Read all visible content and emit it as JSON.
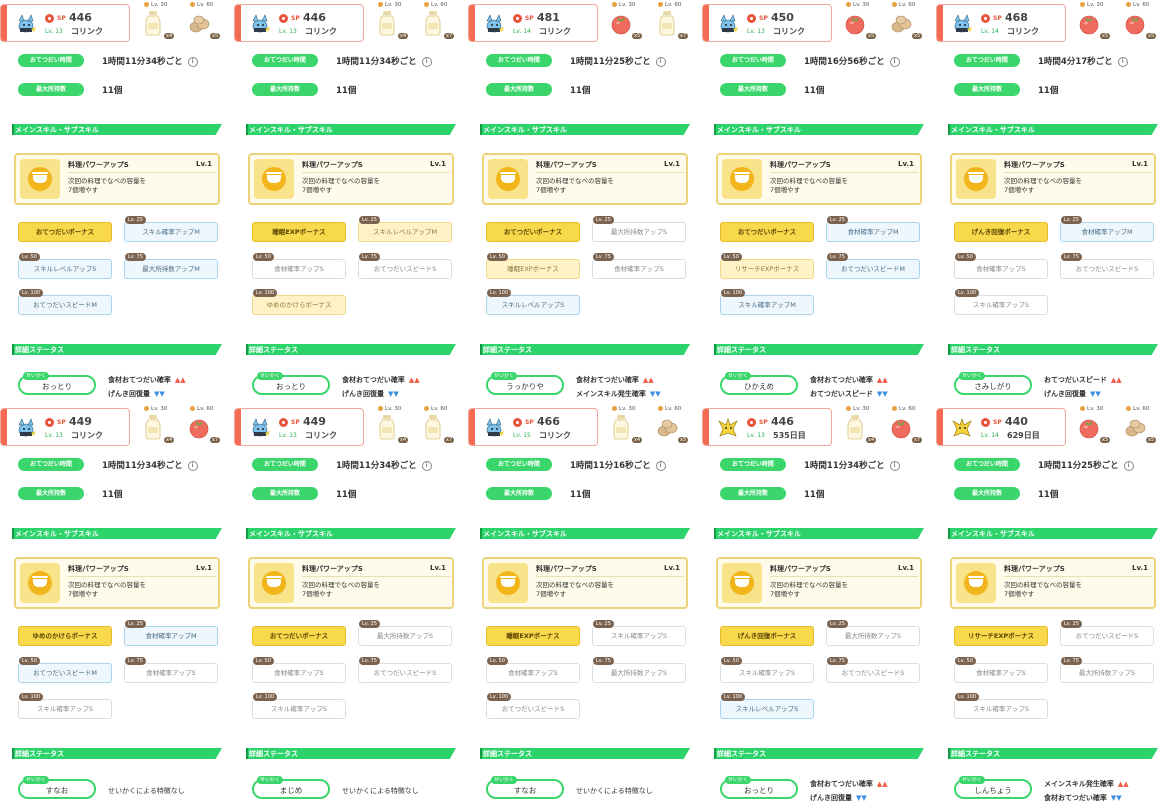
{
  "labels": {
    "help_interval": "おてつだい時間",
    "max_carry": "最大所持数",
    "skills_section": "メインスキル・サブスキル",
    "status_section": "詳細ステータス",
    "nature_tag": "せいかく",
    "sp_label": "SP",
    "up_arrows": "▲▲",
    "down_arrows": "▼▼"
  },
  "colors": {
    "accent_green": "#3bd66b",
    "header_red": "#f26b52",
    "skill_gold": "#f2b51a"
  },
  "panels": [
    {
      "sp": "446",
      "level": "Lv. 13",
      "name": "コリンク",
      "mon": "blue",
      "ing1": {
        "lv": "Lv. 30",
        "type": "milk",
        "count": "x4"
      },
      "ing2": {
        "lv": "Lv. 60",
        "type": "potato",
        "count": "x5"
      },
      "interval": "1時間11分34秒ごと",
      "capacity": "11個",
      "skill": {
        "name": "料理パワーアップS",
        "level": "Lv.1",
        "desc1": "次回の料理でなべの容量を",
        "desc2": "7個増やす"
      },
      "subs": [
        {
          "lv": "",
          "label": "おてつだいボーナス",
          "style": "gold"
        },
        {
          "lv": "Lv. 25",
          "label": "スキル確率アップM",
          "style": "blue"
        },
        {
          "lv": "Lv. 50",
          "label": "スキルレベルアップS",
          "style": "blue"
        },
        {
          "lv": "Lv. 75",
          "label": "最大所持数アップM",
          "style": "blue"
        },
        {
          "lv": "Lv. 100",
          "label": "おてつだいスピードM",
          "style": "blue"
        }
      ],
      "nature": "おっとり",
      "eff1": "食材おてつだい確率",
      "eff1dir": "up",
      "eff2": "げんき回復量",
      "eff2dir": "down"
    },
    {
      "sp": "446",
      "level": "Lv. 13",
      "name": "コリンク",
      "mon": "blue",
      "ing1": {
        "lv": "Lv. 30",
        "type": "milk",
        "count": "x4"
      },
      "ing2": {
        "lv": "Lv. 60",
        "type": "milk",
        "count": "x7"
      },
      "interval": "1時間11分34秒ごと",
      "capacity": "11個",
      "skill": {
        "name": "料理パワーアップS",
        "level": "Lv.1",
        "desc1": "次回の料理でなべの容量を",
        "desc2": "7個増やす"
      },
      "subs": [
        {
          "lv": "",
          "label": "睡眠EXPボーナス",
          "style": "gold"
        },
        {
          "lv": "Lv. 25",
          "label": "スキルレベルアップM",
          "style": "cream"
        },
        {
          "lv": "Lv. 50",
          "label": "食材確率アップS",
          "style": "white"
        },
        {
          "lv": "Lv. 75",
          "label": "おてつだいスピードS",
          "style": "white"
        },
        {
          "lv": "Lv. 100",
          "label": "ゆめのかけらボーナス",
          "style": "cream"
        }
      ],
      "nature": "おっとり",
      "eff1": "食材おてつだい確率",
      "eff1dir": "up",
      "eff2": "げんき回復量",
      "eff2dir": "down"
    },
    {
      "sp": "481",
      "level": "Lv. 14",
      "name": "コリンク",
      "mon": "blue",
      "ing1": {
        "lv": "Lv. 30",
        "type": "tomato",
        "count": "x5"
      },
      "ing2": {
        "lv": "Lv. 60",
        "type": "milk",
        "count": "x7"
      },
      "interval": "1時間11分25秒ごと",
      "capacity": "11個",
      "skill": {
        "name": "料理パワーアップS",
        "level": "Lv.1",
        "desc1": "次回の料理でなべの容量を",
        "desc2": "7個増やす"
      },
      "subs": [
        {
          "lv": "",
          "label": "おてつだいボーナス",
          "style": "gold"
        },
        {
          "lv": "Lv. 25",
          "label": "最大所持数アップS",
          "style": "white"
        },
        {
          "lv": "Lv. 50",
          "label": "睡眠EXPボーナス",
          "style": "cream"
        },
        {
          "lv": "Lv. 75",
          "label": "食材確率アップS",
          "style": "white"
        },
        {
          "lv": "Lv. 100",
          "label": "スキルレベルアップS",
          "style": "blue"
        }
      ],
      "nature": "うっかりや",
      "eff1": "食材おてつだい確率",
      "eff1dir": "up",
      "eff2": "メインスキル発生確率",
      "eff2dir": "down"
    },
    {
      "sp": "450",
      "level": "Lv. 13",
      "name": "コリンク",
      "mon": "blue",
      "ing1": {
        "lv": "Lv. 30",
        "type": "tomato",
        "count": "x5"
      },
      "ing2": {
        "lv": "Lv. 60",
        "type": "potato",
        "count": "x5"
      },
      "interval": "1時間16分56秒ごと",
      "capacity": "11個",
      "skill": {
        "name": "料理パワーアップS",
        "level": "Lv.1",
        "desc1": "次回の料理でなべの容量を",
        "desc2": "7個増やす"
      },
      "subs": [
        {
          "lv": "",
          "label": "おてつだいボーナス",
          "style": "gold"
        },
        {
          "lv": "Lv. 25",
          "label": "食材確率アップM",
          "style": "blue"
        },
        {
          "lv": "Lv. 50",
          "label": "リサーチEXPボーナス",
          "style": "cream"
        },
        {
          "lv": "Lv. 75",
          "label": "おてつだいスピードM",
          "style": "blue"
        },
        {
          "lv": "Lv. 100",
          "label": "スキル確率アップM",
          "style": "blue"
        }
      ],
      "nature": "ひかえめ",
      "eff1": "食材おてつだい確率",
      "eff1dir": "up",
      "eff2": "おてつだいスピード",
      "eff2dir": "down"
    },
    {
      "sp": "468",
      "level": "Lv. 14",
      "name": "コリンク",
      "mon": "blue",
      "ing1": {
        "lv": "Lv. 30",
        "type": "tomato",
        "count": "x5"
      },
      "ing2": {
        "lv": "Lv. 60",
        "type": "tomato",
        "count": "x5"
      },
      "interval": "1時間4分17秒ごと",
      "capacity": "11個",
      "skill": {
        "name": "料理パワーアップS",
        "level": "Lv.1",
        "desc1": "次回の料理でなべの容量を",
        "desc2": "7個増やす"
      },
      "subs": [
        {
          "lv": "",
          "label": "げんき回復ボーナス",
          "style": "gold"
        },
        {
          "lv": "Lv. 25",
          "label": "食材確率アップM",
          "style": "blue"
        },
        {
          "lv": "Lv. 50",
          "label": "食材確率アップS",
          "style": "white"
        },
        {
          "lv": "Lv. 75",
          "label": "おてつだいスピードS",
          "style": "white"
        },
        {
          "lv": "Lv. 100",
          "label": "スキル確率アップS",
          "style": "white"
        }
      ],
      "nature": "さみしがり",
      "eff1": "おてつだいスピード",
      "eff1dir": "up",
      "eff2": "げんき回復量",
      "eff2dir": "down"
    },
    {
      "sp": "449",
      "level": "Lv. 13",
      "name": "コリンク",
      "mon": "blue",
      "ing1": {
        "lv": "Lv. 30",
        "type": "milk",
        "count": "x4"
      },
      "ing2": {
        "lv": "Lv. 60",
        "type": "tomato",
        "count": "x7"
      },
      "interval": "1時間11分34秒ごと",
      "capacity": "11個",
      "skill": {
        "name": "料理パワーアップS",
        "level": "Lv.1",
        "desc1": "次回の料理でなべの容量を",
        "desc2": "7個増やす"
      },
      "subs": [
        {
          "lv": "",
          "label": "ゆめのかけらボーナス",
          "style": "gold"
        },
        {
          "lv": "Lv. 25",
          "label": "食材確率アップM",
          "style": "blue"
        },
        {
          "lv": "Lv. 50",
          "label": "おてつだいスピードM",
          "style": "blue"
        },
        {
          "lv": "Lv. 75",
          "label": "食材確率アップS",
          "style": "white"
        },
        {
          "lv": "Lv. 100",
          "label": "スキル確率アップS",
          "style": "white"
        }
      ],
      "nature": "すなお",
      "eff1": "せいかくによる特徴なし",
      "eff1dir": "",
      "eff2": "",
      "eff2dir": ""
    },
    {
      "sp": "449",
      "level": "Lv. 13",
      "name": "コリンク",
      "mon": "blue",
      "ing1": {
        "lv": "Lv. 30",
        "type": "milk",
        "count": "x4"
      },
      "ing2": {
        "lv": "Lv. 60",
        "type": "milk",
        "count": "x7"
      },
      "interval": "1時間11分34秒ごと",
      "capacity": "11個",
      "skill": {
        "name": "料理パワーアップS",
        "level": "Lv.1",
        "desc1": "次回の料理でなべの容量を",
        "desc2": "7個増やす"
      },
      "subs": [
        {
          "lv": "",
          "label": "おてつだいボーナス",
          "style": "gold"
        },
        {
          "lv": "Lv. 25",
          "label": "最大所持数アップS",
          "style": "white"
        },
        {
          "lv": "Lv. 50",
          "label": "食材確率アップS",
          "style": "white"
        },
        {
          "lv": "Lv. 75",
          "label": "おてつだいスピードS",
          "style": "white"
        },
        {
          "lv": "Lv. 100",
          "label": "スキル確率アップS",
          "style": "white"
        }
      ],
      "nature": "まじめ",
      "eff1": "せいかくによる特徴なし",
      "eff1dir": "",
      "eff2": "",
      "eff2dir": ""
    },
    {
      "sp": "466",
      "level": "Lv. 15",
      "name": "コリンク",
      "mon": "blue",
      "ing1": {
        "lv": "Lv. 30",
        "type": "milk",
        "count": "x4"
      },
      "ing2": {
        "lv": "Lv. 60",
        "type": "potato",
        "count": "x5"
      },
      "interval": "1時間11分16秒ごと",
      "capacity": "11個",
      "skill": {
        "name": "料理パワーアップS",
        "level": "Lv.1",
        "desc1": "次回の料理でなべの容量を",
        "desc2": "7個増やす"
      },
      "subs": [
        {
          "lv": "",
          "label": "睡眠EXPボーナス",
          "style": "gold"
        },
        {
          "lv": "Lv. 25",
          "label": "スキル確率アップS",
          "style": "white"
        },
        {
          "lv": "Lv. 50",
          "label": "食材確率アップS",
          "style": "white"
        },
        {
          "lv": "Lv. 75",
          "label": "最大所持数アップS",
          "style": "white"
        },
        {
          "lv": "Lv. 100",
          "label": "おてつだいスピードS",
          "style": "white"
        }
      ],
      "nature": "すなお",
      "eff1": "せいかくによる特徴なし",
      "eff1dir": "",
      "eff2": "",
      "eff2dir": ""
    },
    {
      "sp": "446",
      "level": "Lv. 13",
      "name": "535日目",
      "mon": "yellow",
      "ing1": {
        "lv": "Lv. 30",
        "type": "milk",
        "count": "x4"
      },
      "ing2": {
        "lv": "Lv. 60",
        "type": "tomato",
        "count": "x7"
      },
      "interval": "1時間11分34秒ごと",
      "capacity": "11個",
      "skill": {
        "name": "料理パワーアップS",
        "level": "Lv.1",
        "desc1": "次回の料理でなべの容量を",
        "desc2": "7個増やす"
      },
      "subs": [
        {
          "lv": "",
          "label": "げんき回復ボーナス",
          "style": "gold"
        },
        {
          "lv": "Lv. 25",
          "label": "最大所持数アップS",
          "style": "white"
        },
        {
          "lv": "Lv. 50",
          "label": "スキル確率アップS",
          "style": "white"
        },
        {
          "lv": "Lv. 75",
          "label": "おてつだいスピードS",
          "style": "white"
        },
        {
          "lv": "Lv. 100",
          "label": "スキルレベルアップS",
          "style": "blue"
        }
      ],
      "nature": "おっとり",
      "eff1": "食材おてつだい確率",
      "eff1dir": "up",
      "eff2": "げんき回復量",
      "eff2dir": "down"
    },
    {
      "sp": "440",
      "level": "Lv. 14",
      "name": "629日目",
      "mon": "yellow",
      "ing1": {
        "lv": "Lv. 30",
        "type": "tomato",
        "count": "x5"
      },
      "ing2": {
        "lv": "Lv. 60",
        "type": "potato",
        "count": "x5"
      },
      "interval": "1時間11分25秒ごと",
      "capacity": "11個",
      "skill": {
        "name": "料理パワーアップS",
        "level": "Lv.1",
        "desc1": "次回の料理でなべの容量を",
        "desc2": "7個増やす"
      },
      "subs": [
        {
          "lv": "",
          "label": "リサーチEXPボーナス",
          "style": "gold"
        },
        {
          "lv": "Lv. 25",
          "label": "おてつだいスピードS",
          "style": "white"
        },
        {
          "lv": "Lv. 50",
          "label": "食材確率アップS",
          "style": "white"
        },
        {
          "lv": "Lv. 75",
          "label": "最大所持数アップS",
          "style": "white"
        },
        {
          "lv": "Lv. 100",
          "label": "スキル確率アップS",
          "style": "white"
        }
      ],
      "nature": "しんちょう",
      "eff1": "メインスキル発生確率",
      "eff1dir": "up",
      "eff2": "食材おてつだい確率",
      "eff2dir": "down"
    }
  ]
}
